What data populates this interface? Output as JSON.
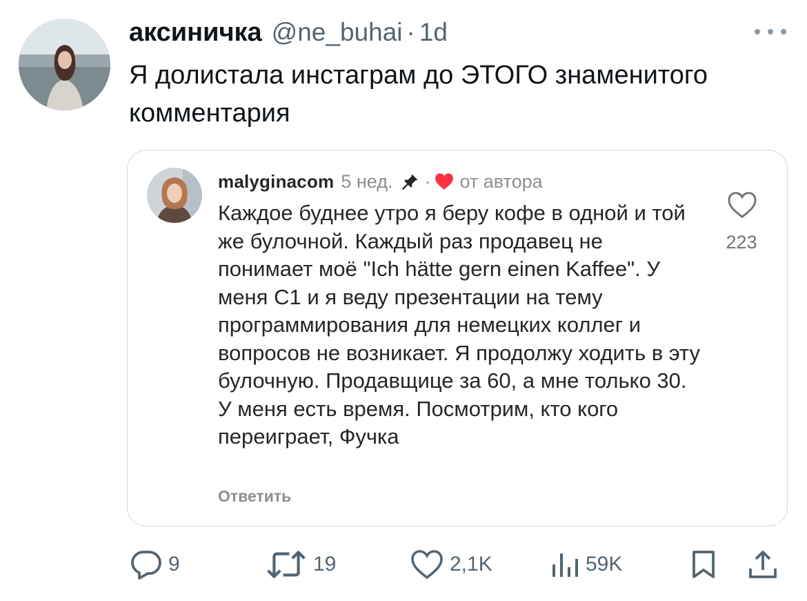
{
  "tweet": {
    "display_name": "аксиничка",
    "handle": "@ne_buhai",
    "separator": "·",
    "time": "1d",
    "text": "Я долистала инстаграм до ЭТОГО знаменитого комментария"
  },
  "embedded_comment": {
    "username": "malyginacom",
    "age": "5 нед.",
    "separator": "·",
    "author_label": "от автора",
    "text": "Каждое буднее утро я беру кофе в одной и той же булочной. Каждый раз продавец не понимает моё \"Ich hätte gern einen Kaffee\". У меня С1 и я веду презентации на тему программирования для немецких коллег и вопросов не возникает. Я продолжу ходить в эту булочную. Продавщице за 60, а мне только 30. У меня есть время. Посмотрим, кто кого переиграет, Фучка",
    "like_count": "223",
    "reply_label": "Ответить",
    "heart_color": "#ff3040"
  },
  "actions": {
    "replies": "9",
    "retweets": "19",
    "likes": "2,1K",
    "views": "59K"
  },
  "colors": {
    "text": "#0f1419",
    "secondary": "#536471",
    "card_border": "#cfd9de"
  }
}
